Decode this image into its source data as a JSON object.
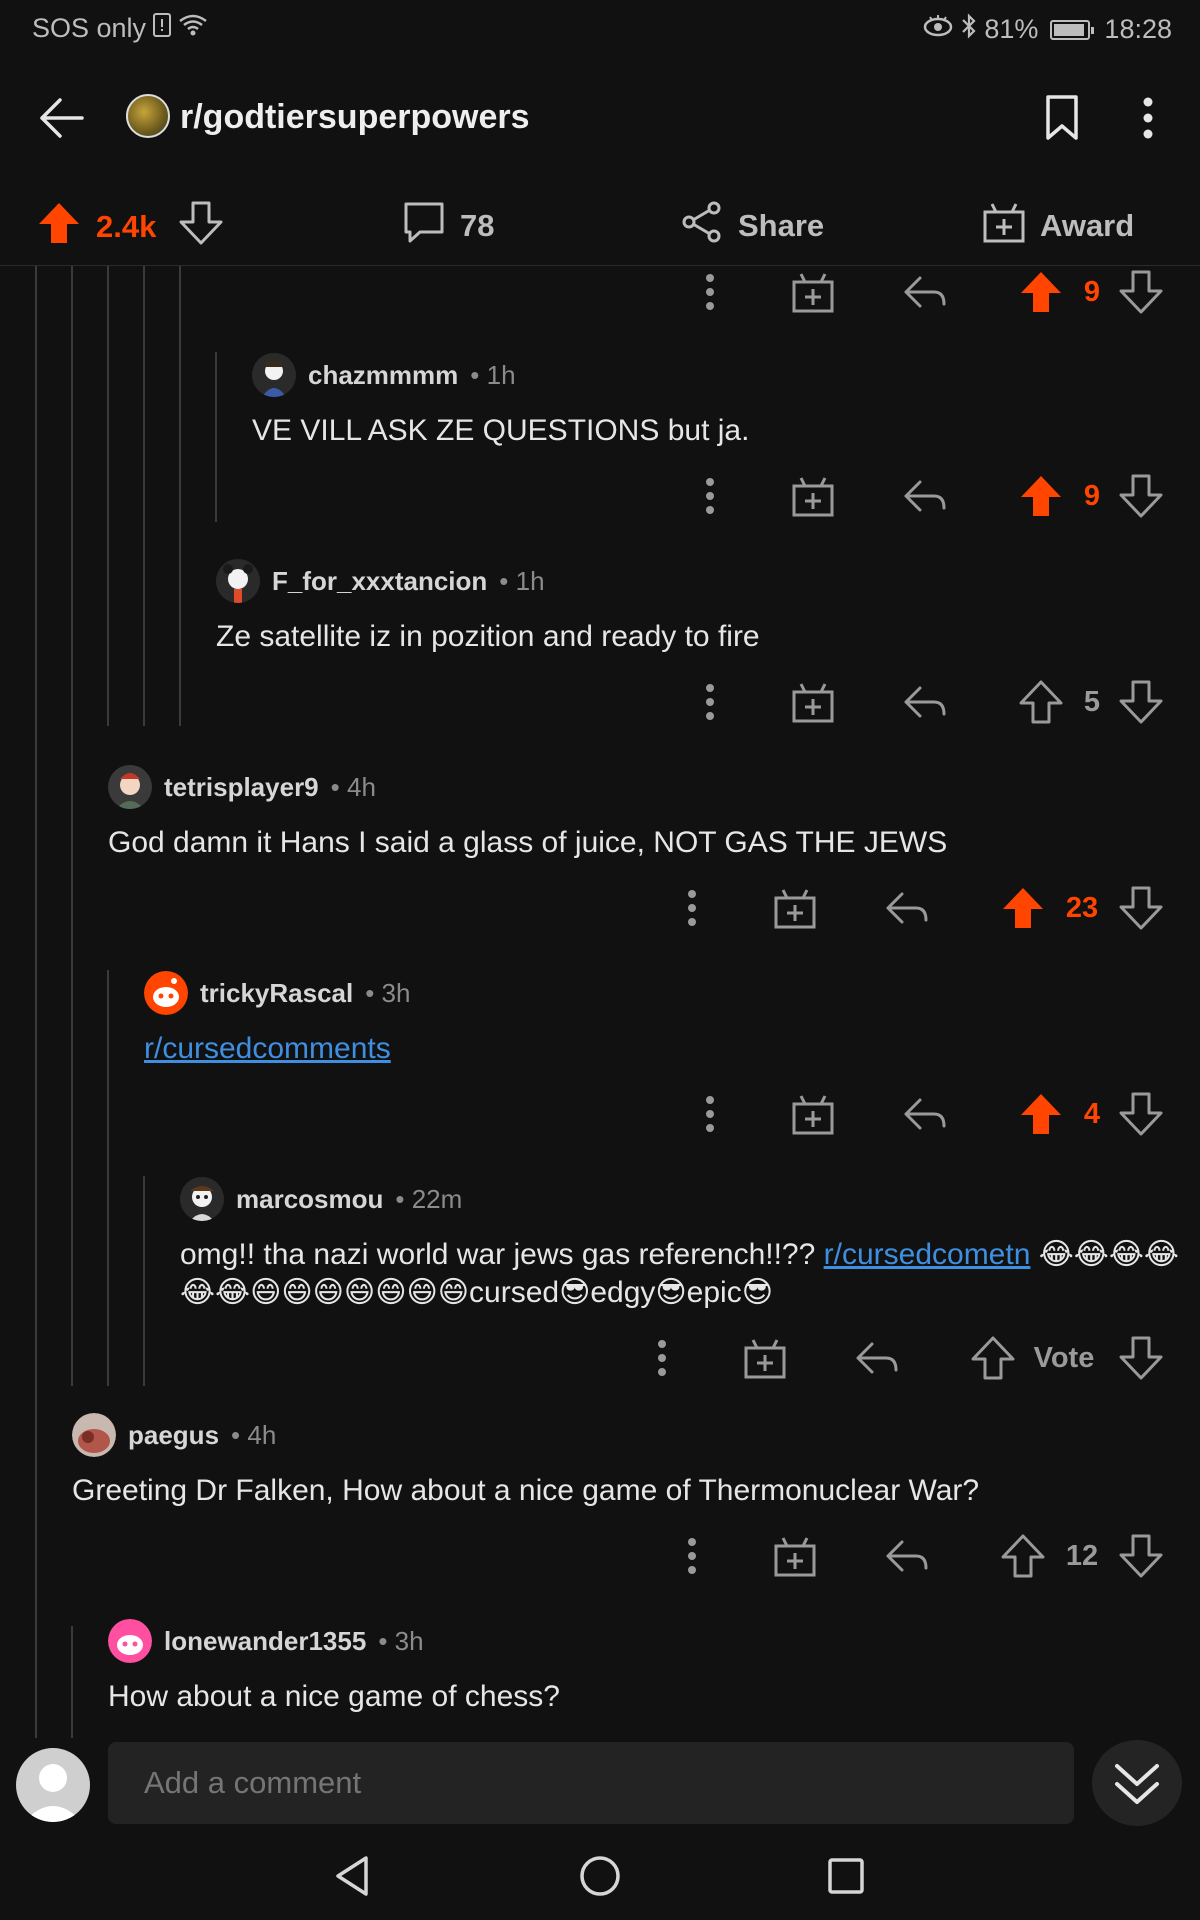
{
  "status": {
    "network": "SOS only",
    "battery": "81%",
    "time": "18:28",
    "battery_level": 0.81
  },
  "header": {
    "subreddit": "r/godtiersuperpowers"
  },
  "post_actions": {
    "upvotes": "2.4k",
    "comments": "78",
    "share_label": "Share",
    "award_label": "Award"
  },
  "comments": [
    {
      "score": "9"
    },
    {
      "user": "chazmmmm",
      "time": "• 1h",
      "body": "VE VILL ASK ZE QUESTIONS but ja.",
      "score": "9"
    },
    {
      "user": "F_for_xxxtancion",
      "time": "• 1h",
      "body": "Ze satellite iz in pozition and ready to fire",
      "score": "5"
    },
    {
      "user": "tetrisplayer9",
      "time": "• 4h",
      "body": "God damn it Hans I said a glass of juice, NOT GAS THE JEWS",
      "score": "23"
    },
    {
      "user": "trickyRascal",
      "time": "• 3h",
      "link": "r/cursedcomments",
      "score": "4"
    },
    {
      "user": "marcosmou",
      "time": "• 22m",
      "body_pre": "omg!! tha nazi world war jews gas referench!!?? ",
      "link": "r/cursedcometn",
      "body_post": " 😂😂😂😂😂😂😄😄😄😄😄😄😄cursed😎edgy😎epic😎",
      "score": "Vote"
    },
    {
      "user": "paegus",
      "time": "• 4h",
      "body": "Greeting Dr Falken, How about a nice game of Thermonuclear War?",
      "score": "12"
    },
    {
      "user": "lonewander1355",
      "time": "• 3h",
      "body": "How about a nice game of chess?"
    }
  ],
  "composer": {
    "placeholder": "Add a comment"
  }
}
